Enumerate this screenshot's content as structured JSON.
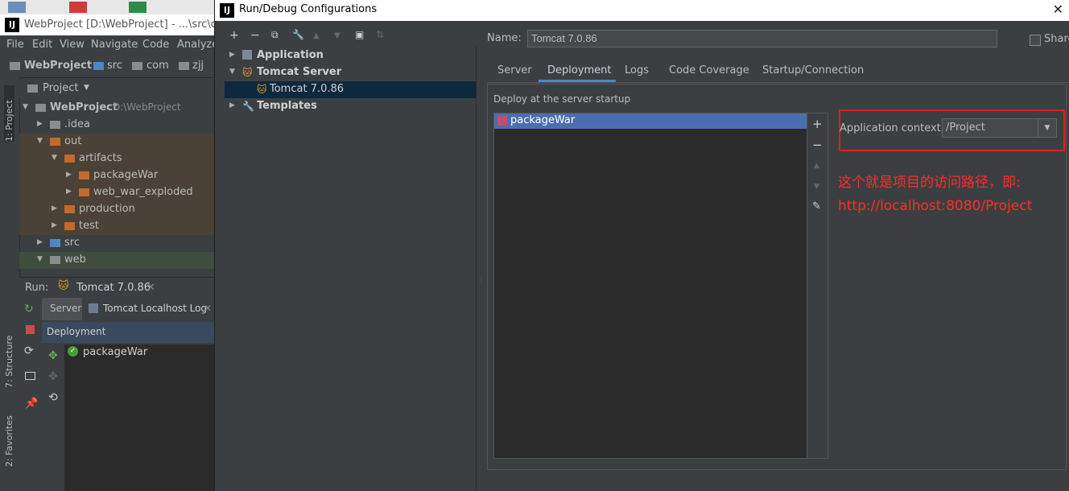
{
  "ide": {
    "window_title": "WebProject [D:\\WebProject] - ...\\src\\com",
    "logo": "IJ",
    "menu": [
      "File",
      "Edit",
      "View",
      "Navigate",
      "Code",
      "Analyze"
    ],
    "breadcrumb": [
      "WebProject",
      "src",
      "com",
      "zjj"
    ],
    "side_tabs": [
      "1: Project",
      "7: Structure",
      "2: Favorites"
    ],
    "project_dropdown": "Project",
    "tree": [
      {
        "label": "WebProject",
        "extra": "D:\\WebProject",
        "expanded": true,
        "level": 0
      },
      {
        "label": ".idea",
        "expanded": false,
        "level": 1
      },
      {
        "label": "out",
        "expanded": true,
        "level": 1
      },
      {
        "label": "artifacts",
        "expanded": true,
        "level": 2
      },
      {
        "label": "packageWar",
        "expanded": false,
        "level": 3
      },
      {
        "label": "web_war_exploded",
        "expanded": false,
        "level": 3
      },
      {
        "label": "production",
        "expanded": false,
        "level": 2
      },
      {
        "label": "test",
        "expanded": false,
        "level": 2
      },
      {
        "label": "src",
        "expanded": false,
        "level": 1
      },
      {
        "label": "web",
        "expanded": true,
        "level": 1
      }
    ],
    "run": {
      "label": "Run:",
      "config_tab": "Tomcat 7.0.86",
      "tabs": [
        "Server",
        "Tomcat Localhost Log"
      ],
      "deployment_header": "Deployment",
      "artifact": "packageWar"
    }
  },
  "dialog": {
    "title": "Run/Debug Configurations",
    "logo": "IJ",
    "tree": [
      {
        "label": "Application",
        "expanded": false
      },
      {
        "label": "Tomcat Server",
        "expanded": true
      },
      {
        "label": "Tomcat 7.0.86",
        "selected": true
      },
      {
        "label": "Templates",
        "expanded": false
      }
    ],
    "name_label": "Name:",
    "name_value": "Tomcat 7.0.86",
    "share_label": "Share",
    "tabs": [
      "Server",
      "Deployment",
      "Logs",
      "Code Coverage",
      "Startup/Connection"
    ],
    "active_tab": "Deployment",
    "deploy_title": "Deploy at the server startup",
    "deploy_items": [
      "packageWar"
    ],
    "context_label": "Application context:",
    "context_value": "/Project",
    "annotation_line1": "这个就是项目的访问路径，即:",
    "annotation_line2": "http://localhost:8080/Project"
  },
  "colors": {
    "highlight_red": "#e02020",
    "annotation_red": "#ff2a2a",
    "selection_blue": "#4b6eaf",
    "tab_underline": "#4a88c7"
  }
}
